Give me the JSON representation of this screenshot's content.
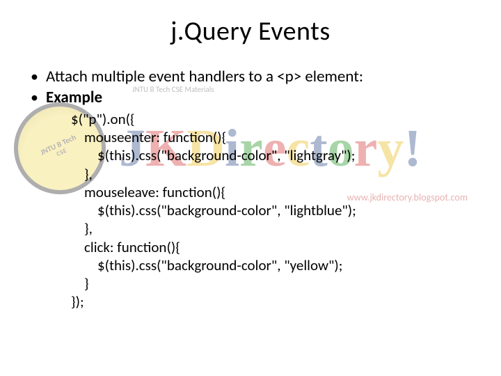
{
  "title": "j.Query Events",
  "bullets": [
    {
      "text": "Attach multiple event handlers to a <p> element:",
      "bold": false
    },
    {
      "text": "Example",
      "bold": true
    }
  ],
  "code": "$(\"p\").on({\n    mouseenter: function(){\n        $(this).css(\"background-color\", \"lightgray\");\n    },\n    mouseleave: function(){\n        $(this).css(\"background-color\", \"lightblue\");\n    },\n    click: function(){\n        $(this).css(\"background-color\", \"yellow\");\n    }\n});",
  "watermark": {
    "badge_line1": "JNTU B Tech",
    "badge_line2": "CSE",
    "subhead": "JNTU B Tech CSE Materials",
    "word_letters": [
      "J",
      "K",
      "D",
      "i",
      "r",
      "e",
      "c",
      "t",
      "o",
      "r",
      "y",
      "!"
    ],
    "word_colors": [
      "c-navy",
      "c-red",
      "c-yellow",
      "c-navy",
      "c-green",
      "c-red",
      "c-yellow",
      "c-navy",
      "c-green",
      "c-red",
      "c-yellow",
      "c-navy"
    ],
    "link": "www.jkdirectory.blogspot.com"
  }
}
